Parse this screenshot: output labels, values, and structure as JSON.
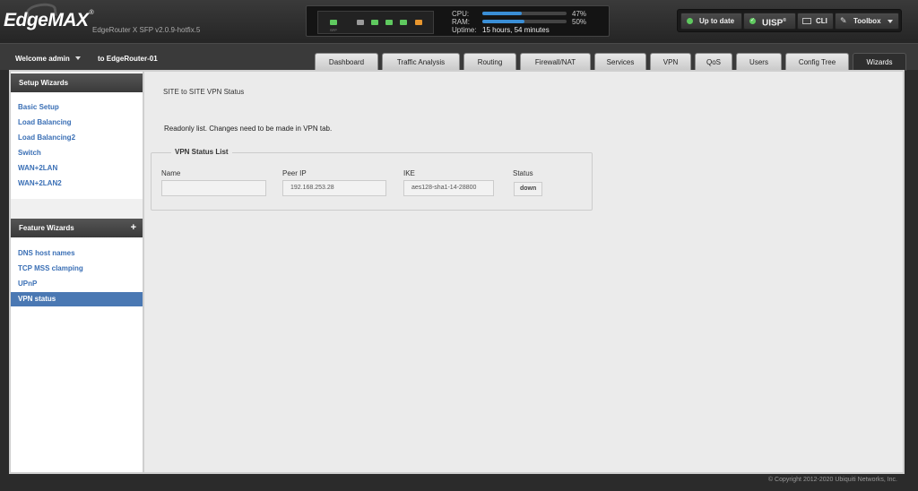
{
  "header": {
    "logo": "EdgeMAX",
    "firmware": "EdgeRouter X SFP v2.0.9-hotfix.5",
    "ports": {
      "sfp_label": "SFP",
      "colors": [
        "#5fc95f",
        "#9a9a9a",
        "#5fc95f",
        "#5fc95f",
        "#5fc95f",
        "#e8962e"
      ]
    },
    "stats": {
      "cpu_label": "CPU:",
      "cpu_pct": 47,
      "cpu_text": "47%",
      "ram_label": "RAM:",
      "ram_pct": 50,
      "ram_text": "50%",
      "uptime_label": "Uptime:",
      "uptime_value": "15 hours, 54 minutes"
    },
    "buttons": {
      "uptodate": "Up to date",
      "uisp": "UISP",
      "cli": "CLI",
      "toolbox": "Toolbox"
    }
  },
  "nav": {
    "welcome": "Welcome admin",
    "router": "to EdgeRouter-01",
    "tabs": [
      "Dashboard",
      "Traffic Analysis",
      "Routing",
      "Firewall/NAT",
      "Services",
      "VPN",
      "QoS",
      "Users",
      "Config Tree",
      "Wizards"
    ],
    "active_tab": "Wizards"
  },
  "sidebar": {
    "setup_heading": "Setup Wizards",
    "setup_items": [
      "Basic Setup",
      "Load Balancing",
      "Load Balancing2",
      "Switch",
      "WAN+2LAN",
      "WAN+2LAN2"
    ],
    "feature_heading": "Feature Wizards",
    "feature_plus": "+",
    "feature_items": [
      "DNS host names",
      "TCP MSS clamping",
      "UPnP",
      "VPN status"
    ],
    "active_item": "VPN status"
  },
  "main": {
    "title": "SITE to SITE VPN Status",
    "readonly_note": "Readonly list. Changes need to be made in VPN tab.",
    "fieldset_legend": "VPN Status List",
    "columns": {
      "name": "Name",
      "peer_ip": "Peer IP",
      "ike": "IKE",
      "status": "Status"
    },
    "row": {
      "name": "",
      "peer_ip": "192.168.253.28",
      "ike": "aes128-sha1-14-28800",
      "status": "down"
    }
  },
  "footer": {
    "copyright": "© Copyright 2012-2020 Ubiquiti Networks, Inc."
  }
}
